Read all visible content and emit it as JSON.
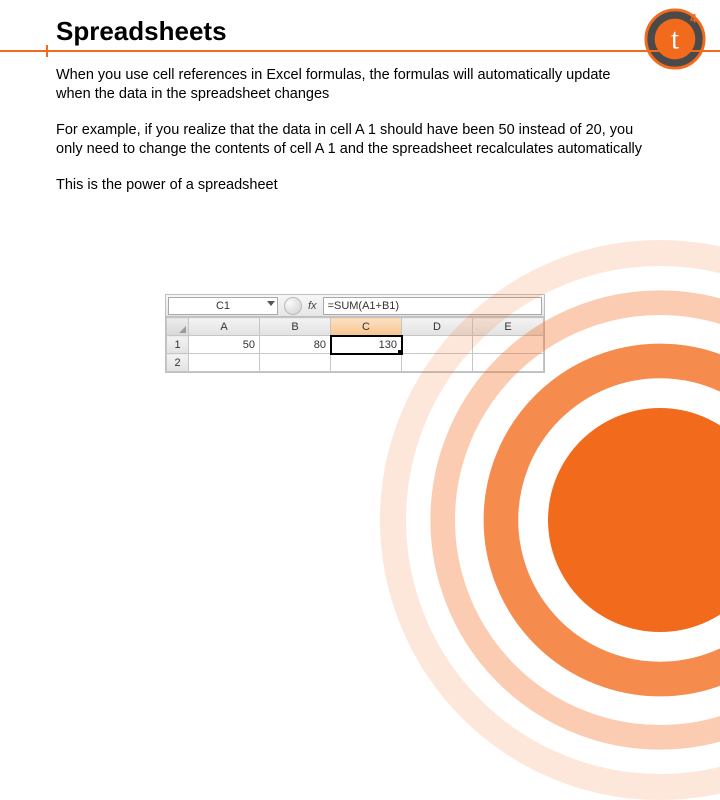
{
  "title": "Spreadsheets",
  "body": {
    "p1": "When you use cell references in Excel formulas, the formulas will automatically update when the data in the spreadsheet changes",
    "p2": "For example, if you realize that the data in cell A 1 should have been 50 instead of 20, you only need to change the contents of cell A 1 and the spreadsheet recalculates automatically",
    "p3": "This is the power of a spreadsheet"
  },
  "excel": {
    "namebox": "C1",
    "fx": "fx",
    "formula": "=SUM(A1+B1)",
    "columns": [
      "A",
      "B",
      "C",
      "D",
      "E"
    ],
    "rows": [
      {
        "hdr": "1",
        "cells": [
          "50",
          "80",
          "130",
          "",
          ""
        ]
      },
      {
        "hdr": "2",
        "cells": [
          "",
          "",
          "",
          "",
          ""
        ]
      }
    ],
    "active": {
      "row": 0,
      "col": 2
    }
  },
  "logo": {
    "letter": "t",
    "sup": "4"
  }
}
